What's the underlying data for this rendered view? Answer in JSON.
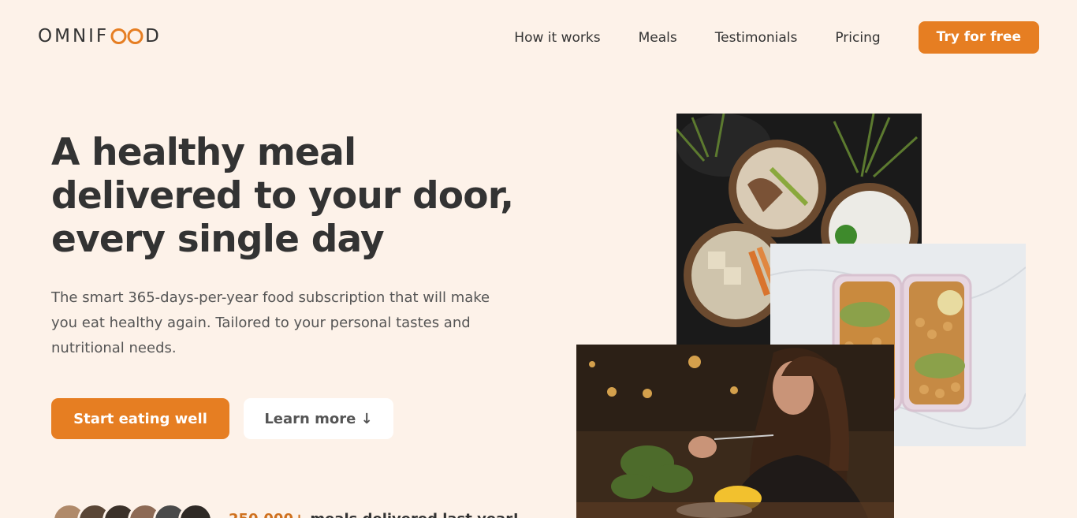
{
  "header": {
    "logo_text_left": "OMNIF",
    "logo_text_right": "D",
    "nav": [
      {
        "label": "How it works"
      },
      {
        "label": "Meals"
      },
      {
        "label": "Testimonials"
      },
      {
        "label": "Pricing"
      }
    ],
    "cta_label": "Try for free"
  },
  "hero": {
    "title": "A healthy meal delivered to your door, every single day",
    "description": "The smart 365-days-per-year food subscription that will make you eat healthy again. Tailored to your personal tastes and nutritional needs.",
    "primary_button": "Start eating well",
    "secondary_button": "Learn more ↓",
    "delivered_number": "250,000+",
    "delivered_text": " meals delivered last year!"
  },
  "colors": {
    "background": "#fdf2e9",
    "accent": "#e67e22",
    "text": "#333333"
  }
}
